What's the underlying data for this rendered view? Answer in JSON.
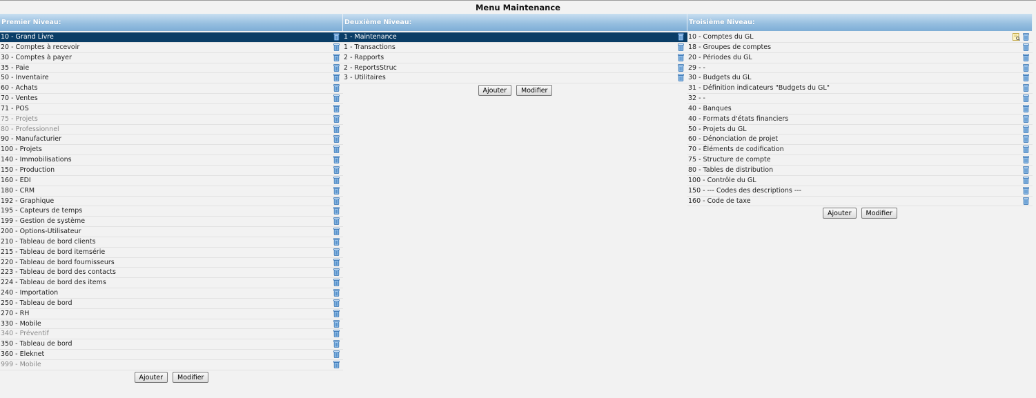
{
  "title": "Menu Maintenance",
  "columns": [
    {
      "header": "Premier Niveau:",
      "items": [
        {
          "label": "10 - Grand Livre",
          "selected": true
        },
        {
          "label": "20 - Comptes à recevoir"
        },
        {
          "label": "30 - Comptes à payer"
        },
        {
          "label": "35 - Paie"
        },
        {
          "label": "50 - Inventaire"
        },
        {
          "label": "60 - Achats"
        },
        {
          "label": "70 - Ventes"
        },
        {
          "label": "71 - POS"
        },
        {
          "label": "75 - Projets",
          "disabled": true
        },
        {
          "label": "80 - Professionnel",
          "disabled": true
        },
        {
          "label": "90 - Manufacturier"
        },
        {
          "label": "100 - Projets"
        },
        {
          "label": "140 - Immobilisations"
        },
        {
          "label": "150 - Production"
        },
        {
          "label": "160 - EDI"
        },
        {
          "label": "180 - CRM"
        },
        {
          "label": "192 - Graphique"
        },
        {
          "label": "195 - Capteurs de temps"
        },
        {
          "label": "199 - Gestion de système"
        },
        {
          "label": "200 - Options-Utilisateur"
        },
        {
          "label": "210 - Tableau de bord clients"
        },
        {
          "label": "215 - Tableau de bord itemsérie"
        },
        {
          "label": "220 - Tableau de bord fournisseurs"
        },
        {
          "label": "223 - Tableau de bord des contacts"
        },
        {
          "label": "224 - Tableau de bord des items"
        },
        {
          "label": "240 - Importation"
        },
        {
          "label": "250 - Tableau de bord"
        },
        {
          "label": "270 - RH"
        },
        {
          "label": "330 - Mobile"
        },
        {
          "label": "340 - Préventif",
          "disabled": true
        },
        {
          "label": "350 - Tableau de bord"
        },
        {
          "label": "360 - Eleknet"
        },
        {
          "label": "999 - Mobile",
          "disabled": true
        }
      ],
      "add_label": "Ajouter",
      "edit_label": "Modifier"
    },
    {
      "header": "Deuxième Niveau:",
      "items": [
        {
          "label": "1 - Maintenance",
          "selected": true
        },
        {
          "label": "1 - Transactions"
        },
        {
          "label": "2 - Rapports"
        },
        {
          "label": "2 - ReportsStruc"
        },
        {
          "label": "3 - Utilitaires"
        }
      ],
      "add_label": "Ajouter",
      "edit_label": "Modifier"
    },
    {
      "header": "Troisième Niveau:",
      "items": [
        {
          "label": "10 - Comptes du GL",
          "edit_icon": true
        },
        {
          "label": "18 - Groupes de comptes"
        },
        {
          "label": "20 - Périodes du GL"
        },
        {
          "label": "29 - -"
        },
        {
          "label": "30 - Budgets du GL"
        },
        {
          "label": "31 - Définition indicateurs \"Budgets du GL\""
        },
        {
          "label": "32 - -"
        },
        {
          "label": "40 - Banques"
        },
        {
          "label": "40 - Formats d'états financiers"
        },
        {
          "label": "50 - Projets du GL"
        },
        {
          "label": "60 - Dénonciation de projet"
        },
        {
          "label": "70 - Éléments de codification"
        },
        {
          "label": "75 - Structure de compte"
        },
        {
          "label": "80 - Tables de distribution"
        },
        {
          "label": "100 - Contrôle du GL"
        },
        {
          "label": "150 - --- Codes des descriptions ---"
        },
        {
          "label": "160 - Code de taxe"
        }
      ],
      "add_label": "Ajouter",
      "edit_label": "Modifier"
    }
  ],
  "icons": {
    "delete": "trash-can-icon",
    "edit": "edit-note-icon"
  },
  "colors": {
    "selected_row": "#0a3d66",
    "header_top": "#c9dff1",
    "header_bottom": "#7eaed6",
    "disabled_text": "#8a8a8a"
  }
}
